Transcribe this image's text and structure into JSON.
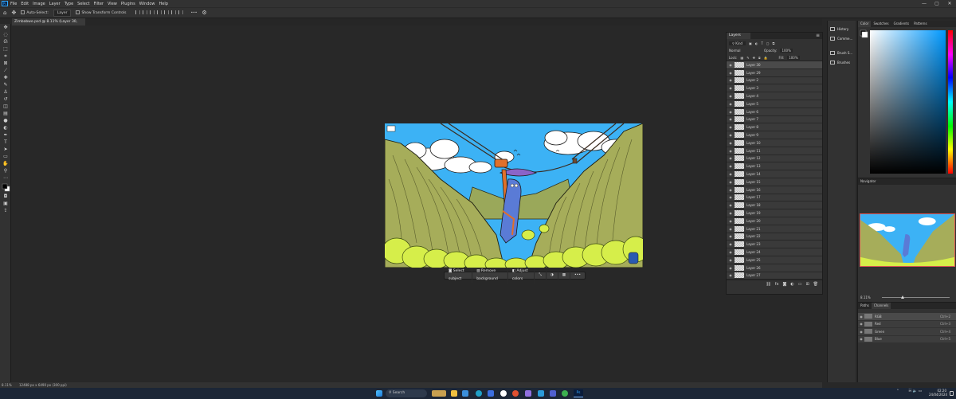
{
  "menubar": {
    "app_icon": "Ps",
    "items": [
      "File",
      "Edit",
      "Image",
      "Layer",
      "Type",
      "Select",
      "Filter",
      "View",
      "Plugins",
      "Window",
      "Help"
    ],
    "window_controls": [
      "—",
      "▢",
      "✕"
    ]
  },
  "options_bar": {
    "auto_select_label": "Auto-Select:",
    "auto_select_target": "Layer",
    "transform_controls_label": "Show Transform Controls",
    "more_label": "•••"
  },
  "document": {
    "tab_title": "Zimbabwe.psd @ 8.11% (Layer 30, RGB/8#)",
    "close_glyph": "×"
  },
  "contextual_taskbar": {
    "select_subject": "Select subject",
    "remove_background": "Remove background",
    "adjust_colors": "Adjust colors",
    "more": "•••"
  },
  "status_bar": {
    "zoom": "8.11%",
    "doc_size": "12488 px x 6490 px (300 ppi)"
  },
  "layers_panel": {
    "tab": "Layers",
    "kind_filter": "Kind",
    "blend_mode": "Normal",
    "opacity_label": "Opacity:",
    "opacity_value": "100%",
    "lock_label": "Lock:",
    "fill_label": "Fill:",
    "fill_value": "100%",
    "layers": [
      "Layer 30",
      "Layer 29",
      "Layer 2",
      "Layer 3",
      "Layer 4",
      "Layer 5",
      "Layer 6",
      "Layer 7",
      "Layer 8",
      "Layer 9",
      "Layer 10",
      "Layer 11",
      "Layer 12",
      "Layer 13",
      "Layer 14",
      "Layer 15",
      "Layer 16",
      "Layer 17",
      "Layer 18",
      "Layer 19",
      "Layer 20",
      "Layer 21",
      "Layer 22",
      "Layer 23",
      "Layer 24",
      "Layer 25",
      "Layer 26",
      "Layer 27"
    ]
  },
  "mid_dock": {
    "items": [
      "History",
      "Comme...",
      "Brush S...",
      "Brushes"
    ]
  },
  "color_panel": {
    "tabs": [
      "Color",
      "Swatches",
      "Gradients",
      "Patterns"
    ]
  },
  "navigator_panel": {
    "title": "Navigator",
    "zoom": "8.11%"
  },
  "channels_panel": {
    "tabs": [
      "Paths",
      "Channels"
    ],
    "channels": [
      {
        "name": "RGB",
        "shortcut": "Ctrl+2"
      },
      {
        "name": "Red",
        "shortcut": "Ctrl+3"
      },
      {
        "name": "Green",
        "shortcut": "Ctrl+4"
      },
      {
        "name": "Blue",
        "shortcut": "Ctrl+5"
      }
    ]
  },
  "taskbar": {
    "search_placeholder": "Search",
    "ps_label": "Ps",
    "time": "02:20",
    "date": "24/04/2024"
  }
}
